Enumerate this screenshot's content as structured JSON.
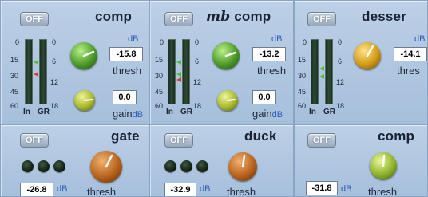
{
  "modules": {
    "comp": {
      "off_label": "OFF",
      "title": "comp",
      "thresh": {
        "db_label": "dB",
        "value": "-15.8",
        "label": "thresh"
      },
      "gain": {
        "value": "0.0",
        "label": "gain",
        "unit": "dB"
      },
      "meter": {
        "left_scale": [
          "0",
          "15",
          "30",
          "45",
          "60"
        ],
        "right_scale": [
          "0",
          "6",
          "12",
          "18"
        ],
        "in_label": "In",
        "gr_label": "GR"
      }
    },
    "mb_comp": {
      "off_label": "OFF",
      "title_prefix": "mb",
      "title": "comp",
      "thresh": {
        "db_label": "dB",
        "value": "-13.2",
        "label": "thresh"
      },
      "gain": {
        "value": "0.0",
        "label": "gain",
        "unit": "dB"
      },
      "meter": {
        "left_scale": [
          "0",
          "15",
          "30",
          "45",
          "60"
        ],
        "right_scale": [
          "0",
          "6",
          "12",
          "18"
        ],
        "in_label": "In",
        "gr_label": "GR"
      }
    },
    "desser": {
      "off_label": "OFF",
      "title": "desser",
      "thresh": {
        "db_label": "dB",
        "value": "-14.1",
        "label": "thres"
      },
      "meter": {
        "left_scale": [
          "0",
          "15",
          "30",
          "45",
          "60"
        ],
        "right_scale": [
          "0",
          "6",
          "12",
          "18"
        ],
        "in_label": "In",
        "gr_label": "GR"
      }
    },
    "gate": {
      "off_label": "OFF",
      "title": "gate",
      "value": "-26.8",
      "unit": "dB",
      "knob_label": "thresh"
    },
    "duck": {
      "off_label": "OFF",
      "title": "duck",
      "value": "-32.9",
      "unit": "dB",
      "knob_label": "thresh"
    },
    "comp2": {
      "off_label": "OFF",
      "title": "comp",
      "value": "-31.8",
      "unit": "dB",
      "knob_label": "thresh"
    }
  },
  "colors": {
    "panel": "#b3c9e2",
    "green_knob": "#4c9a2a",
    "yellow_green_knob": "#a9b82c",
    "amber_knob": "#d29a16",
    "orange_knob": "#b8631c",
    "readout_unit": "#2a60b3"
  }
}
